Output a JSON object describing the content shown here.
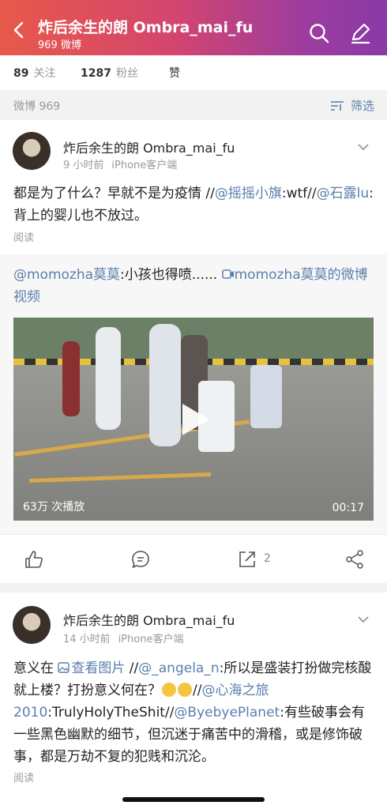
{
  "header": {
    "title": "炸后余生的朗 Ombra_mai_fu",
    "subtitle": "969 微博",
    "gradient_start": "#e8594a",
    "gradient_end": "#8a3aa6"
  },
  "stats": {
    "following_count": "89",
    "following_label": "关注",
    "followers_count": "1287",
    "followers_label": "粉丝",
    "likes_label": "赞"
  },
  "filter": {
    "count_label": "微博 969",
    "filter_label": "筛选"
  },
  "posts": [
    {
      "username": "炸后余生的朗 Ombra_mai_fu",
      "time": "9 小时前",
      "device": "iPhone客户端",
      "text_parts": [
        "都是为了什么？早就不是为疫情 //",
        "@摇摇小旗",
        ":wtf//",
        "@石露lu",
        ":背上的婴儿也不放过。"
      ],
      "read_label": "阅读",
      "repost": {
        "author": "@momozha莫莫",
        "text": ":小孩也得喷......",
        "video_link": "momozha莫莫的微博视频"
      },
      "video": {
        "plays": "63万 次播放",
        "duration": "00:17"
      },
      "actions": {
        "repost_count": "2"
      }
    },
    {
      "username": "炸后余生的朗 Ombra_mai_fu",
      "time": "14 小时前",
      "device": "iPhone客户端",
      "text_a": "意义在 ",
      "image_link": "查看图片",
      "text_b": " //",
      "mention1": "@_angela_n",
      "text_c": ":所以是盛装打扮做完核酸就上楼？打扮意义何在？",
      "text_d": "//",
      "mention2": "@心海之旅2010",
      "text_e": ":TrulyHolyTheShit//",
      "mention3": "@ByebyePlanet",
      "text_f": ":有些破事会有一些黑色幽默的细节，但沉迷于痛苦中的滑稽，或是修饰破事，都是万劫不复的犯贱和沉沦。",
      "read_label": "阅读"
    }
  ],
  "colors": {
    "link": "#5b7fad",
    "muted": "#999999"
  }
}
